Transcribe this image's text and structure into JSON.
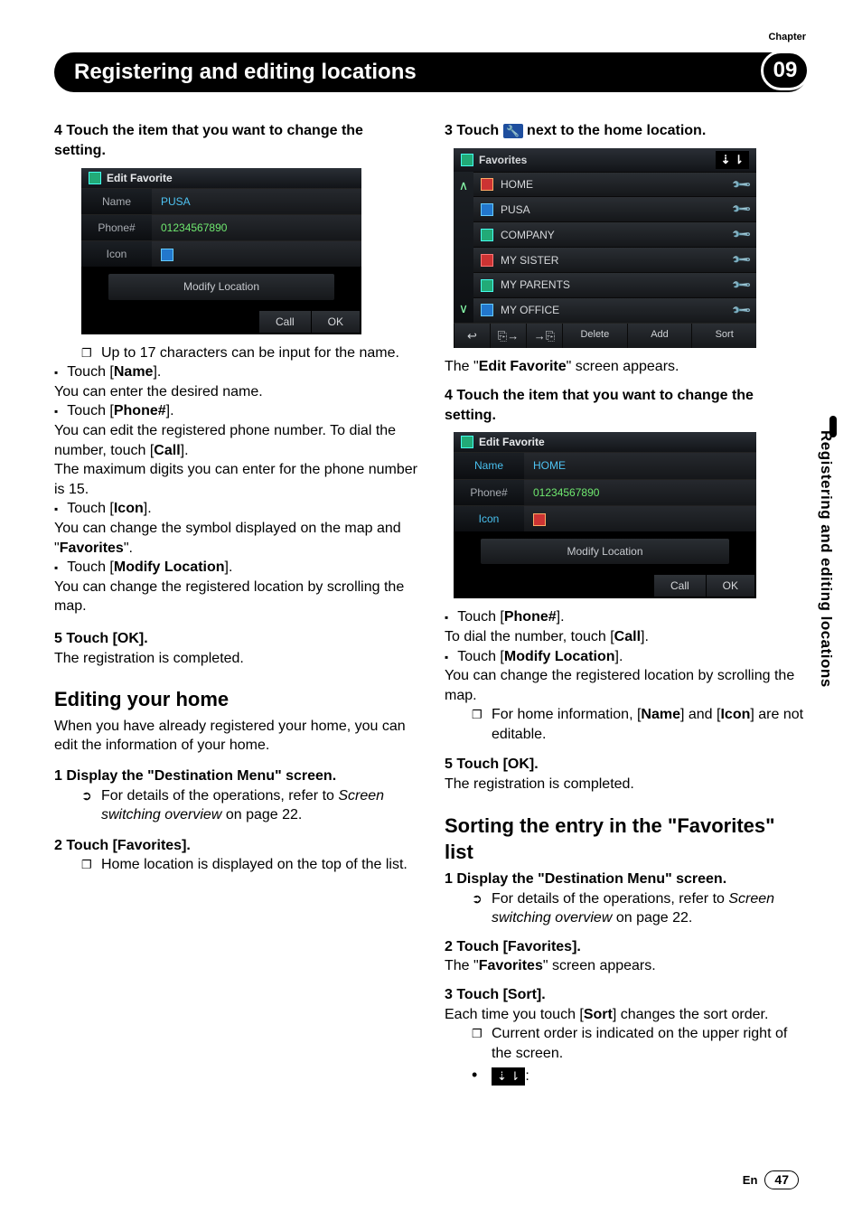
{
  "chapter_label": "Chapter",
  "chapter_num": "09",
  "title": "Registering and editing locations",
  "side_tab": "Registering and editing locations",
  "footer_lang": "En",
  "footer_page": "47",
  "left": {
    "step4_head": "4   Touch the item that you want to change the setting.",
    "shot1": {
      "title": "Edit Favorite",
      "rows": {
        "name_lbl": "Name",
        "name_val": "PUSA",
        "phone_lbl": "Phone#",
        "phone_val": "01234567890",
        "icon_lbl": "Icon"
      },
      "modify": "Modify Location",
      "call": "Call",
      "ok": "OK"
    },
    "note_chars": "Up to 17 characters can be input for the name.",
    "b_name": "Touch [Name].",
    "t_name": "You can enter the desired name.",
    "b_phone": "Touch [Phone#].",
    "t_phone1": "You can edit the registered phone number. To dial the number, touch [Call].",
    "t_phone2": "The maximum digits you can enter for the phone number is 15.",
    "b_icon": "Touch [Icon].",
    "t_icon": "You can change the symbol displayed on the map and \"Favorites\".",
    "b_modloc": "Touch [Modify Location].",
    "t_modloc": "You can change the registered location by scrolling the map.",
    "step5_head": "5   Touch [OK].",
    "step5_body": "The registration is completed.",
    "h2_edit_home": "Editing your home",
    "edit_home_intro": "When you have already registered your home, you can edit the information of your home.",
    "eh_step1": "1   Display the \"Destination Menu\" screen.",
    "eh_step1_ref_a": "For details of the operations, refer to ",
    "eh_step1_ref_b": "Screen switching overview",
    "eh_step1_ref_c": " on page 22.",
    "eh_step2": "2   Touch [Favorites].",
    "eh_step2_note": "Home location is displayed on the top of the list."
  },
  "right": {
    "step3_head_a": "3   Touch ",
    "step3_head_b": " next to the home location.",
    "fav": {
      "title": "Favorites",
      "items": [
        "HOME",
        "PUSA",
        "COMPANY",
        "MY SISTER",
        "MY PARENTS",
        "MY OFFICE"
      ],
      "bottom": {
        "delete": "Delete",
        "add": "Add",
        "sort": "Sort"
      }
    },
    "after_fav": "The \"Edit Favorite\" screen appears.",
    "step4_head": "4   Touch the item that you want to change the setting.",
    "shot2": {
      "title": "Edit Favorite",
      "rows": {
        "name_lbl": "Name",
        "name_val": "HOME",
        "phone_lbl": "Phone#",
        "phone_val": "01234567890",
        "icon_lbl": "Icon"
      },
      "modify": "Modify Location",
      "call": "Call",
      "ok": "OK"
    },
    "b_phone": "Touch [Phone#].",
    "t_phone": "To dial the number, touch [Call].",
    "b_modloc": "Touch [Modify Location].",
    "t_modloc": "You can change the registered location by scrolling the map.",
    "note_home": "For home information, [Name] and [Icon] are not editable.",
    "step5_head": "5   Touch [OK].",
    "step5_body": "The registration is completed.",
    "h2_sort": "Sorting the entry in the \"Favorites\" list",
    "s_step1": "1   Display the \"Destination Menu\" screen.",
    "s_step1_ref_a": "For details of the operations, refer to ",
    "s_step1_ref_b": "Screen switching overview",
    "s_step1_ref_c": " on page 22.",
    "s_step2": "2   Touch [Favorites].",
    "s_step2_body": "The \"Favorites\" screen appears.",
    "s_step3": "3   Touch [Sort].",
    "s_step3_body": "Each time you touch [Sort] changes the sort order.",
    "s_note1": "Current order is indicated on the upper right of the screen.",
    "s_note2": ":"
  }
}
